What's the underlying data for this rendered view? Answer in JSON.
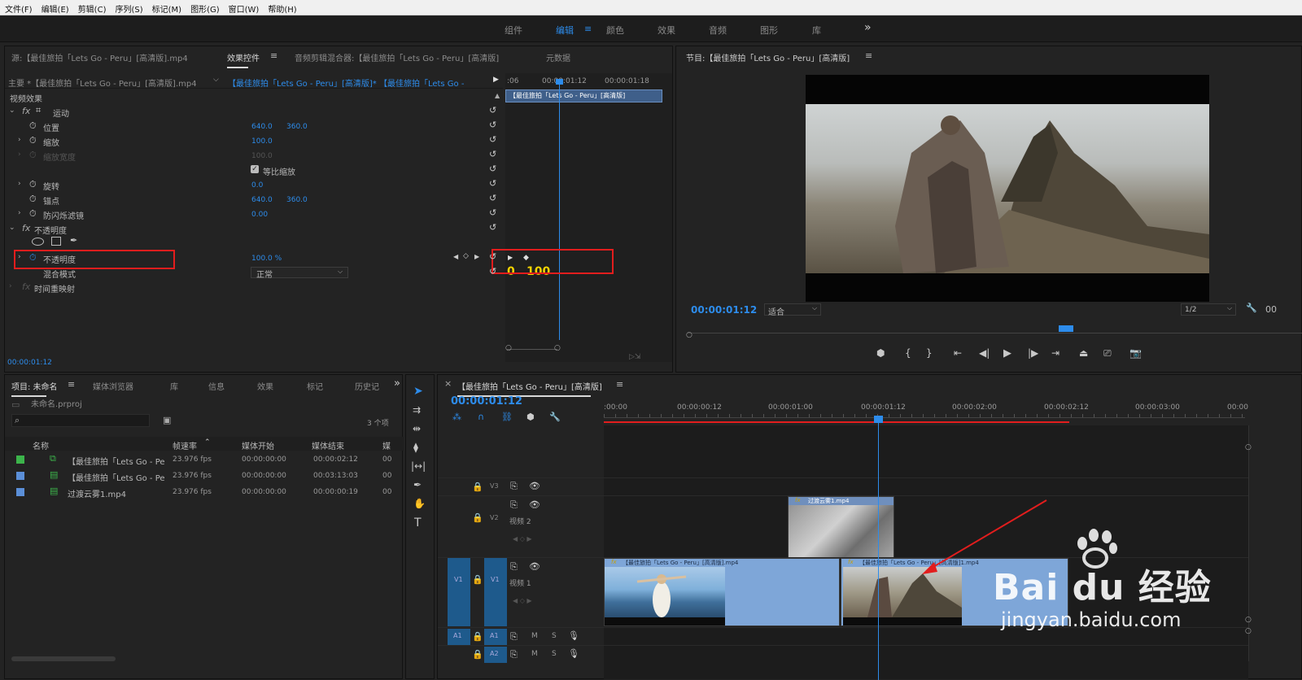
{
  "menu": [
    "文件(F)",
    "编辑(E)",
    "剪辑(C)",
    "序列(S)",
    "标记(M)",
    "图形(G)",
    "窗口(W)",
    "帮助(H)"
  ],
  "workspaces": [
    "组件",
    "编辑",
    "颜色",
    "效果",
    "音频",
    "图形",
    "库"
  ],
  "workspace_more": "»",
  "source": {
    "tab_source": "源:【最佳旅拍「Lets Go - Peru」[高清版].mp4",
    "tab_effect": "效果控件",
    "tab_audio": "音频剪辑混合器:【最佳旅拍「Lets Go - Peru」[高清版]",
    "tab_meta": "元数据",
    "clip_master": "主要 *【最佳旅拍「Lets Go - Peru」[高清版].mp4",
    "clip_seq": "【最佳旅拍「Lets Go - Peru」[高清版]* 【最佳旅拍「Lets Go -",
    "mini_times": [
      ":06",
      "00:00:01:12",
      "00:00:01:18"
    ],
    "mini_clip": "【最佳旅拍「Lets Go - Peru」[高清版]",
    "video_effects": "视频效果",
    "motion": "运动",
    "position": "位置",
    "pos_x": "640.0",
    "pos_y": "360.0",
    "scale": "缩放",
    "scale_v": "100.0",
    "scale_w": "缩放宽度",
    "scale_w_v": "100.0",
    "uniform": "等比缩放",
    "rotation": "旋转",
    "rot_v": "0.0",
    "anchor": "锚点",
    "anc_x": "640.0",
    "anc_y": "360.0",
    "flicker": "防闪烁滤镜",
    "flicker_v": "0.00",
    "opacity_group": "不透明度",
    "opacity": "不透明度",
    "opacity_v": "100.0 %",
    "blend": "混合模式",
    "blend_v": "正常",
    "timeremap": "时间重映射",
    "fx": "fx",
    "key_0": "0",
    "key_100": "100",
    "timecode": "00:00:01:12"
  },
  "program": {
    "title": "节目:【最佳旅拍「Lets Go - Peru」[高清版]",
    "timecode": "00:00:01:12",
    "fit": "适合",
    "res": "1/2",
    "right_tc": "00"
  },
  "project": {
    "tabs": [
      "项目: 未命名",
      "媒体浏览器",
      "库",
      "信息",
      "效果",
      "标记",
      "历史记"
    ],
    "file": "未命名.prproj",
    "count": "3 个项",
    "cols": [
      "名称",
      "帧速率",
      "媒体开始",
      "媒体结束",
      "媒"
    ],
    "rows": [
      {
        "name": "【最佳旅拍「Lets Go - Pe",
        "fps": "23.976 fps",
        "start": "00:00:00:00",
        "end": "00:00:02:12",
        "m": "00",
        "color": "#3cb44b"
      },
      {
        "name": "【最佳旅拍「Lets Go - Pe",
        "fps": "23.976 fps",
        "start": "00:00:00:00",
        "end": "00:03:13:03",
        "m": "00",
        "color": "#5b8fd8"
      },
      {
        "name": "过渡云雾1.mp4",
        "fps": "23.976 fps",
        "start": "00:00:00:00",
        "end": "00:00:00:19",
        "m": "00",
        "color": "#5b8fd8"
      }
    ]
  },
  "timeline": {
    "title": "【最佳旅拍「Lets Go - Peru」[高清版]",
    "timecode": "00:00:01:12",
    "ruler": [
      ":00:00",
      "00:00:00:12",
      "00:00:01:00",
      "00:00:01:12",
      "00:00:02:00",
      "00:00:02:12",
      "00:00:03:00",
      "00:00"
    ],
    "v3": "V3",
    "v2": "V2",
    "v2name": "视频 2",
    "v1": "V1",
    "v1name": "视频 1",
    "a1": "A1",
    "a2": "A2",
    "m": "M",
    "s": "S",
    "clip_fog": "过渡云雾1.mp4",
    "clip_a": "【最佳旅拍「Lets Go - Peru」[高清版].mp4",
    "clip_b": "【最佳旅拍「Lets Go - Peru」[高清版]1.mp4",
    "fx": "fx"
  },
  "watermark": {
    "brand": "Bai du 经验",
    "url": "jingyan.baidu.com"
  },
  "colors": {
    "accent": "#2d8ceb",
    "red": "#e21d1d"
  }
}
